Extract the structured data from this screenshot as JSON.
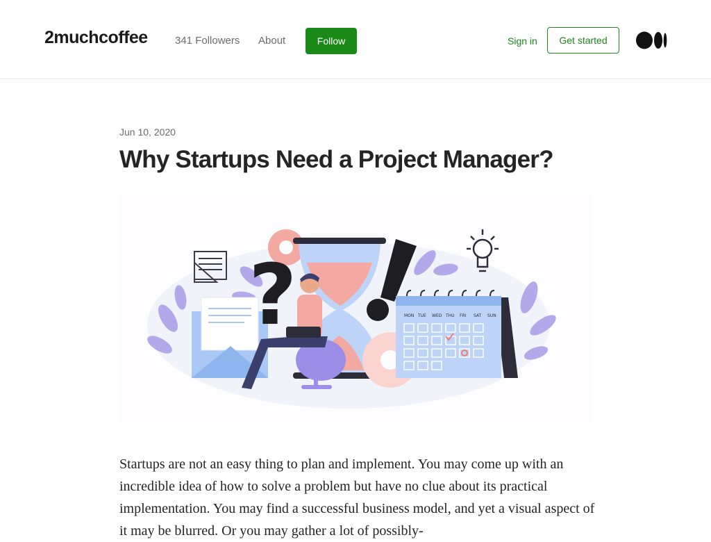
{
  "header": {
    "publication_name": "2muchcoffee",
    "followers": "341 Followers",
    "about_label": "About",
    "follow_label": "Follow",
    "sign_in_label": "Sign in",
    "get_started_label": "Get started",
    "logo_icon": "medium-logo-icon"
  },
  "article": {
    "date": "Jun 10, 2020",
    "title": "Why Startups Need a Project Manager?",
    "illustration": {
      "calendar_days": [
        "MON",
        "TUE",
        "WED",
        "THU",
        "FRI",
        "SAT",
        "SUN"
      ],
      "icons": [
        "hourglass-icon",
        "question-mark-icon",
        "exclamation-mark-icon",
        "gear-icon",
        "lightbulb-icon",
        "envelope-icon",
        "calendar-icon",
        "blueprint-icon",
        "person-with-laptop-icon"
      ]
    },
    "paragraph": "Startups are not an easy thing to plan and implement. You may come up with an incredible idea of how to solve a problem but have no clue about its practical implementation. You may find a successful business model, and yet a visual aspect of it may be blurred. Or you may gather a lot of possibly-"
  },
  "colors": {
    "accent_green": "#1a8917",
    "text_primary": "#242424",
    "text_secondary": "#6b6b6b"
  }
}
